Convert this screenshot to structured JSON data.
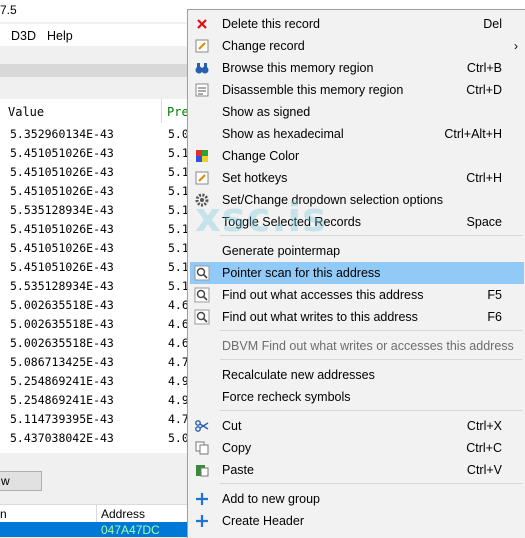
{
  "window": {
    "title_fragment": "7.5"
  },
  "menubar": {
    "d3d": "D3D",
    "help": "Help"
  },
  "results": {
    "columns": {
      "value": "Value",
      "previous": "Pre"
    },
    "rows": [
      {
        "value": "5.352960134E-43",
        "prev": "5.0"
      },
      {
        "value": "5.451051026E-43",
        "prev": "5.1"
      },
      {
        "value": "5.451051026E-43",
        "prev": "5.1"
      },
      {
        "value": "5.451051026E-43",
        "prev": "5.1"
      },
      {
        "value": "5.535128934E-43",
        "prev": "5.1"
      },
      {
        "value": "5.451051026E-43",
        "prev": "5.1"
      },
      {
        "value": "5.451051026E-43",
        "prev": "5.1"
      },
      {
        "value": "5.451051026E-43",
        "prev": "5.1"
      },
      {
        "value": "5.535128934E-43",
        "prev": "5.1"
      },
      {
        "value": "5.002635518E-43",
        "prev": "4.6"
      },
      {
        "value": "5.002635518E-43",
        "prev": "4.6"
      },
      {
        "value": "5.002635518E-43",
        "prev": "4.6"
      },
      {
        "value": "5.086713425E-43",
        "prev": "4.7"
      },
      {
        "value": "5.254869241E-43",
        "prev": "4.9"
      },
      {
        "value": "5.254869241E-43",
        "prev": "4.9"
      },
      {
        "value": "5.114739395E-43",
        "prev": "4.7"
      },
      {
        "value": "5.437038042E-43",
        "prev": "5.0"
      }
    ]
  },
  "bottom_button": "w",
  "address_list": {
    "col1": "n",
    "col2": "Address",
    "selected_address": "047A47DC"
  },
  "watermark": "xsc.is",
  "context_menu": {
    "items": [
      {
        "label": "Delete this record",
        "shortcut": "Del",
        "icon": "red-x-icon"
      },
      {
        "label": "Change record",
        "shortcut": "",
        "icon": "edit-record-icon",
        "submenu_arrow": "›"
      },
      {
        "label": "Browse this memory region",
        "shortcut": "Ctrl+B",
        "icon": "binoculars-icon"
      },
      {
        "label": "Disassemble this memory region",
        "shortcut": "Ctrl+D",
        "icon": "disassemble-icon"
      },
      {
        "label": "Show as signed",
        "shortcut": ""
      },
      {
        "label": "Show as hexadecimal",
        "shortcut": "Ctrl+Alt+H"
      },
      {
        "label": "Change Color",
        "shortcut": "",
        "icon": "color-palette-icon"
      },
      {
        "label": "Set hotkeys",
        "shortcut": "Ctrl+H",
        "icon": "hotkey-icon"
      },
      {
        "label": "Set/Change dropdown selection options",
        "shortcut": "",
        "icon": "gear-icon"
      },
      {
        "label": "Toggle Selected Records",
        "shortcut": "Space"
      },
      {
        "label": "Generate pointermap",
        "shortcut": ""
      },
      {
        "label": "Pointer scan for this address",
        "shortcut": "",
        "icon": "magnifier-icon"
      },
      {
        "label": "Find out what accesses this address",
        "shortcut": "F5",
        "icon": "find-access-icon"
      },
      {
        "label": "Find out what writes to this address",
        "shortcut": "F6",
        "icon": "find-write-icon"
      },
      {
        "label": "DBVM Find out what writes or accesses this address",
        "shortcut": ""
      },
      {
        "label": "Recalculate new addresses",
        "shortcut": ""
      },
      {
        "label": "Force recheck symbols",
        "shortcut": ""
      },
      {
        "label": "Cut",
        "shortcut": "Ctrl+X",
        "icon": "scissors-icon"
      },
      {
        "label": "Copy",
        "shortcut": "Ctrl+C",
        "icon": "copy-icon"
      },
      {
        "label": "Paste",
        "shortcut": "Ctrl+V",
        "icon": "paste-icon"
      },
      {
        "label": "Add to new group",
        "shortcut": "",
        "icon": "plus-icon"
      },
      {
        "label": "Create Header",
        "shortcut": "",
        "icon": "plus-icon"
      }
    ]
  },
  "colors": {
    "highlight": "#91c9f7",
    "selection": "#0078d7",
    "plus": "#1e73d8",
    "delete": "#e01010"
  }
}
